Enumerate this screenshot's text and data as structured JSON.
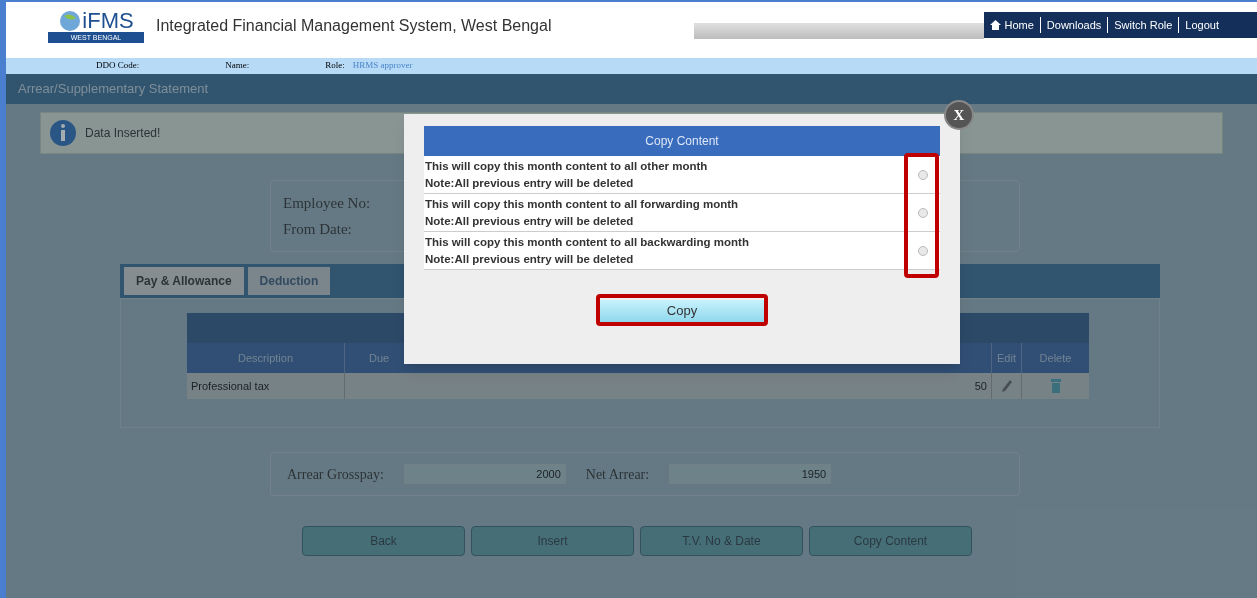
{
  "header": {
    "logo_text": "iFMS",
    "logo_subtext": "WEST BENGAL",
    "title": "Integrated Financial Management System, West Bengal",
    "nav": [
      "Home",
      "Downloads",
      "Switch Role",
      "Logout"
    ]
  },
  "user_bar": {
    "ddo_label": "DDO Code:",
    "name_label": "Name:",
    "role_label": "Role:",
    "role": "HRMS approver"
  },
  "panel_title": "Arrear/Supplementary Statement",
  "message": "Data Inserted!",
  "employee": {
    "labels": [
      "Employee No:",
      "From Date:"
    ]
  },
  "tabs": [
    {
      "label": "Pay & Allowance",
      "selected": true
    },
    {
      "label": "Deduction",
      "selected": false
    }
  ],
  "table": {
    "columns": [
      "Description",
      "Due",
      "Edit",
      "Delete"
    ],
    "rows": [
      {
        "description": "Professional tax",
        "amount_tail": "50"
      }
    ]
  },
  "totals": [
    {
      "label": "Arrear Grosspay:",
      "value": "2000"
    },
    {
      "label": "Net Arrear:",
      "value": "1950"
    }
  ],
  "buttons": [
    "Back",
    "Insert",
    "T.V. No & Date",
    "Copy Content"
  ],
  "dialog": {
    "close": "X",
    "title": "Copy Content",
    "options": [
      {
        "line": "This will copy this month content to all other month",
        "note": "Note:All previous entry will be deleted",
        "selected": false
      },
      {
        "line": "This will copy this month content to all forwarding month",
        "note": "Note:All previous entry will be deleted",
        "selected": false
      },
      {
        "line": "This will copy this month content to all backwarding month",
        "note": "Note:All previous entry will be deleted",
        "selected": false
      }
    ],
    "button": "Copy"
  }
}
